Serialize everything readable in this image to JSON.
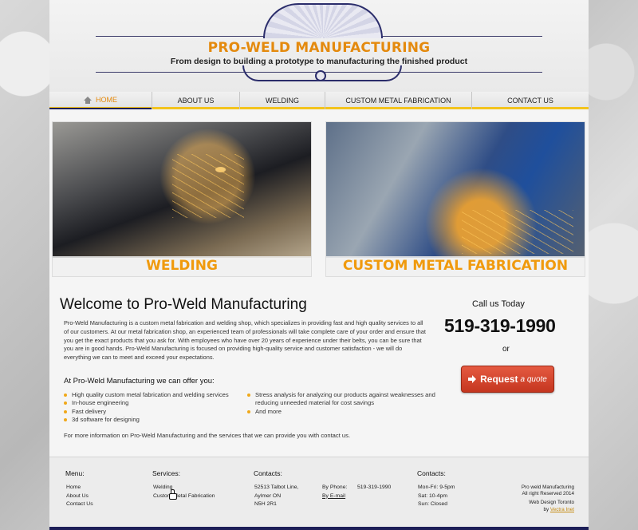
{
  "header": {
    "brand": "PRO-WELD MANUFACTURING",
    "tagline": "From design to building a prototype to manufacturing the finished product"
  },
  "nav": {
    "items": [
      {
        "label": "HOME",
        "active": true,
        "icon": "home-icon"
      },
      {
        "label": "ABOUT US"
      },
      {
        "label": "WELDING"
      },
      {
        "label": "CUSTOM METAL FABRICATION"
      },
      {
        "label": "CONTACT US"
      }
    ]
  },
  "banners": [
    {
      "caption": "WELDING"
    },
    {
      "caption": "CUSTOM METAL FABRICATION"
    }
  ],
  "main": {
    "title": "Welcome to Pro-Weld Manufacturing",
    "intro": "Pro-Weld Manufacturing is a custom metal fabrication and welding shop, which specializes in providing fast and high quality services to all of our customers. At our metal fabrication shop, an experienced team of professionals will take complete care of your order and ensure that you get the exact products that you ask for. With employees who have over 20 years of experience under their belts, you can be sure that you are in good hands. Pro-Weld Manufacturing is focused on providing high-quality service and customer satisfaction - we will do everything we can to meet and exceed your expectations.",
    "offer_heading": "At Pro-Weld Manufacturing we can offer you:",
    "offers_left": [
      "High quality custom metal fabrication and welding services",
      "In-house engineering",
      "Fast delivery",
      "3d software for designing"
    ],
    "offers_right": [
      "Stress analysis for analyzing our products against weaknesses and reducing unneeded material for cost savings",
      "And more"
    ],
    "more_info": "For more information on Pro-Weld Manufacturing and the services that we can provide you with contact us."
  },
  "cta": {
    "call_label": "Call us Today",
    "phone": "519-319-1990",
    "or": "or",
    "request_main": "Request",
    "request_sub": "a quote",
    "icon": "arrow-right-icon"
  },
  "footer": {
    "menu_heading": "Menu:",
    "menu_items": [
      "Home",
      "About Us",
      "Contact Us"
    ],
    "services_heading": "Services:",
    "services_items": [
      "Welding",
      "Custom Metal Fabrication"
    ],
    "contacts_heading": "Contacts:",
    "address": [
      "52513 Talbot Line,",
      "Aylmer ON",
      "N5H 2R1"
    ],
    "by_phone_label": "By Phone:",
    "by_phone_value": "519-319-1990",
    "by_email_label": "By E-mail",
    "hours_heading": "Contacts:",
    "hours": [
      "Mon-Fri: 9-5pm",
      "Sat: 10-4pm",
      "Sun: Closed"
    ],
    "copyright_1": "Pro weld Manufacturing",
    "copyright_2": "All right Reserved 2014",
    "credit_1": "Web Design Toronto",
    "credit_by": "by",
    "credit_link": "Vectra Inet"
  }
}
